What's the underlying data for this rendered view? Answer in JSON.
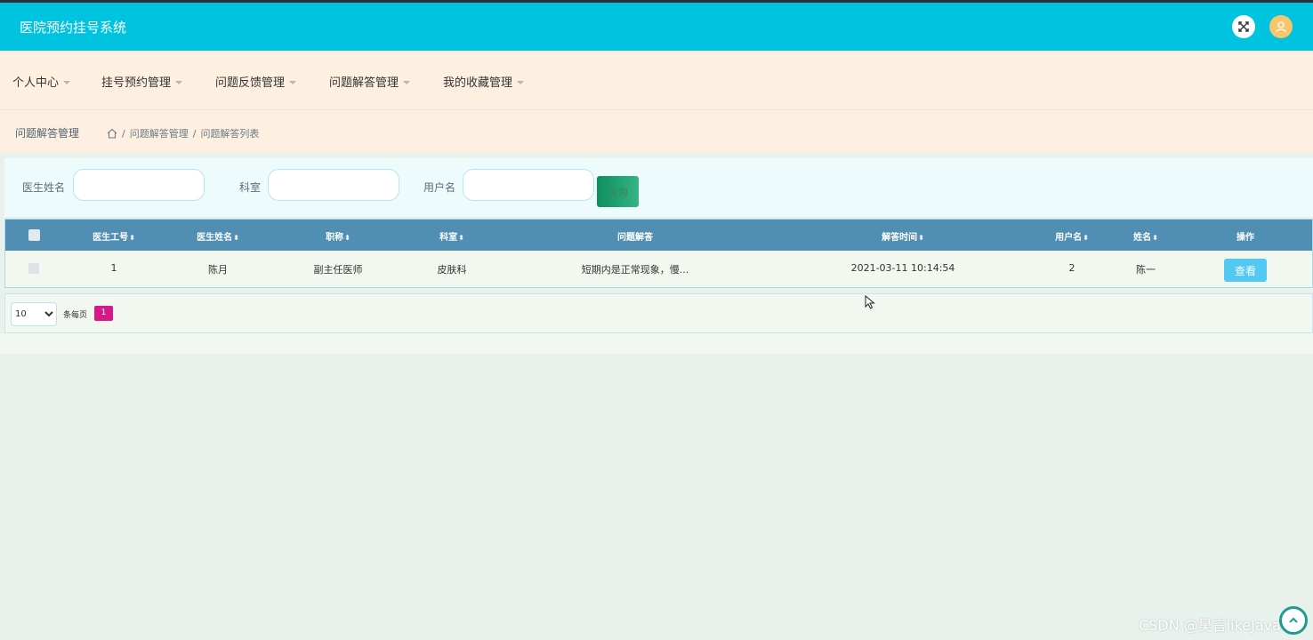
{
  "app": {
    "title": "医院预约挂号系统"
  },
  "icons": {
    "fullscreen": "fullscreen-icon",
    "user": "user-avatar-icon",
    "home": "home-icon",
    "back_to_top": "arrow-up-icon"
  },
  "colors": {
    "topbar": "#00c3df",
    "nav_bg": "#fef0e0",
    "table_header": "#508eb3",
    "search_button": "#0e8f5e",
    "view_button": "#52c9f3",
    "active_page": "#d31b8a"
  },
  "nav": {
    "items": [
      {
        "label": "个人中心"
      },
      {
        "label": "挂号预约管理"
      },
      {
        "label": "问题反馈管理"
      },
      {
        "label": "问题解答管理"
      },
      {
        "label": "我的收藏管理"
      }
    ]
  },
  "breadcrumb": {
    "page_title": "问题解答管理",
    "items": [
      "问题解答管理",
      "问题解答列表"
    ],
    "separator": "/"
  },
  "search": {
    "fields": [
      {
        "label": "医生姓名",
        "value": ""
      },
      {
        "label": "科室",
        "value": ""
      },
      {
        "label": "用户名",
        "value": ""
      }
    ],
    "button_label": "查询"
  },
  "table": {
    "columns": [
      {
        "label": "医生工号",
        "sortable": true
      },
      {
        "label": "医生姓名",
        "sortable": true
      },
      {
        "label": "职称",
        "sortable": true
      },
      {
        "label": "科室",
        "sortable": true
      },
      {
        "label": "问题解答",
        "sortable": false
      },
      {
        "label": "解答时间",
        "sortable": true
      },
      {
        "label": "用户名",
        "sortable": true
      },
      {
        "label": "姓名",
        "sortable": true
      },
      {
        "label": "操作",
        "sortable": false
      }
    ],
    "sort_glyph": "⬍",
    "rows": [
      [
        "1",
        "陈月",
        "副主任医师",
        "皮肤科",
        "短期内是正常现象，慢...",
        "2021-03-11 10:14:54",
        "2",
        "陈一"
      ]
    ],
    "view_label": "查看"
  },
  "pagination": {
    "page_size": "10",
    "page_size_options": [
      "10"
    ],
    "per_page_label": "条每页",
    "current_page": "1"
  },
  "watermark": "CSDN @昊言likeJava"
}
